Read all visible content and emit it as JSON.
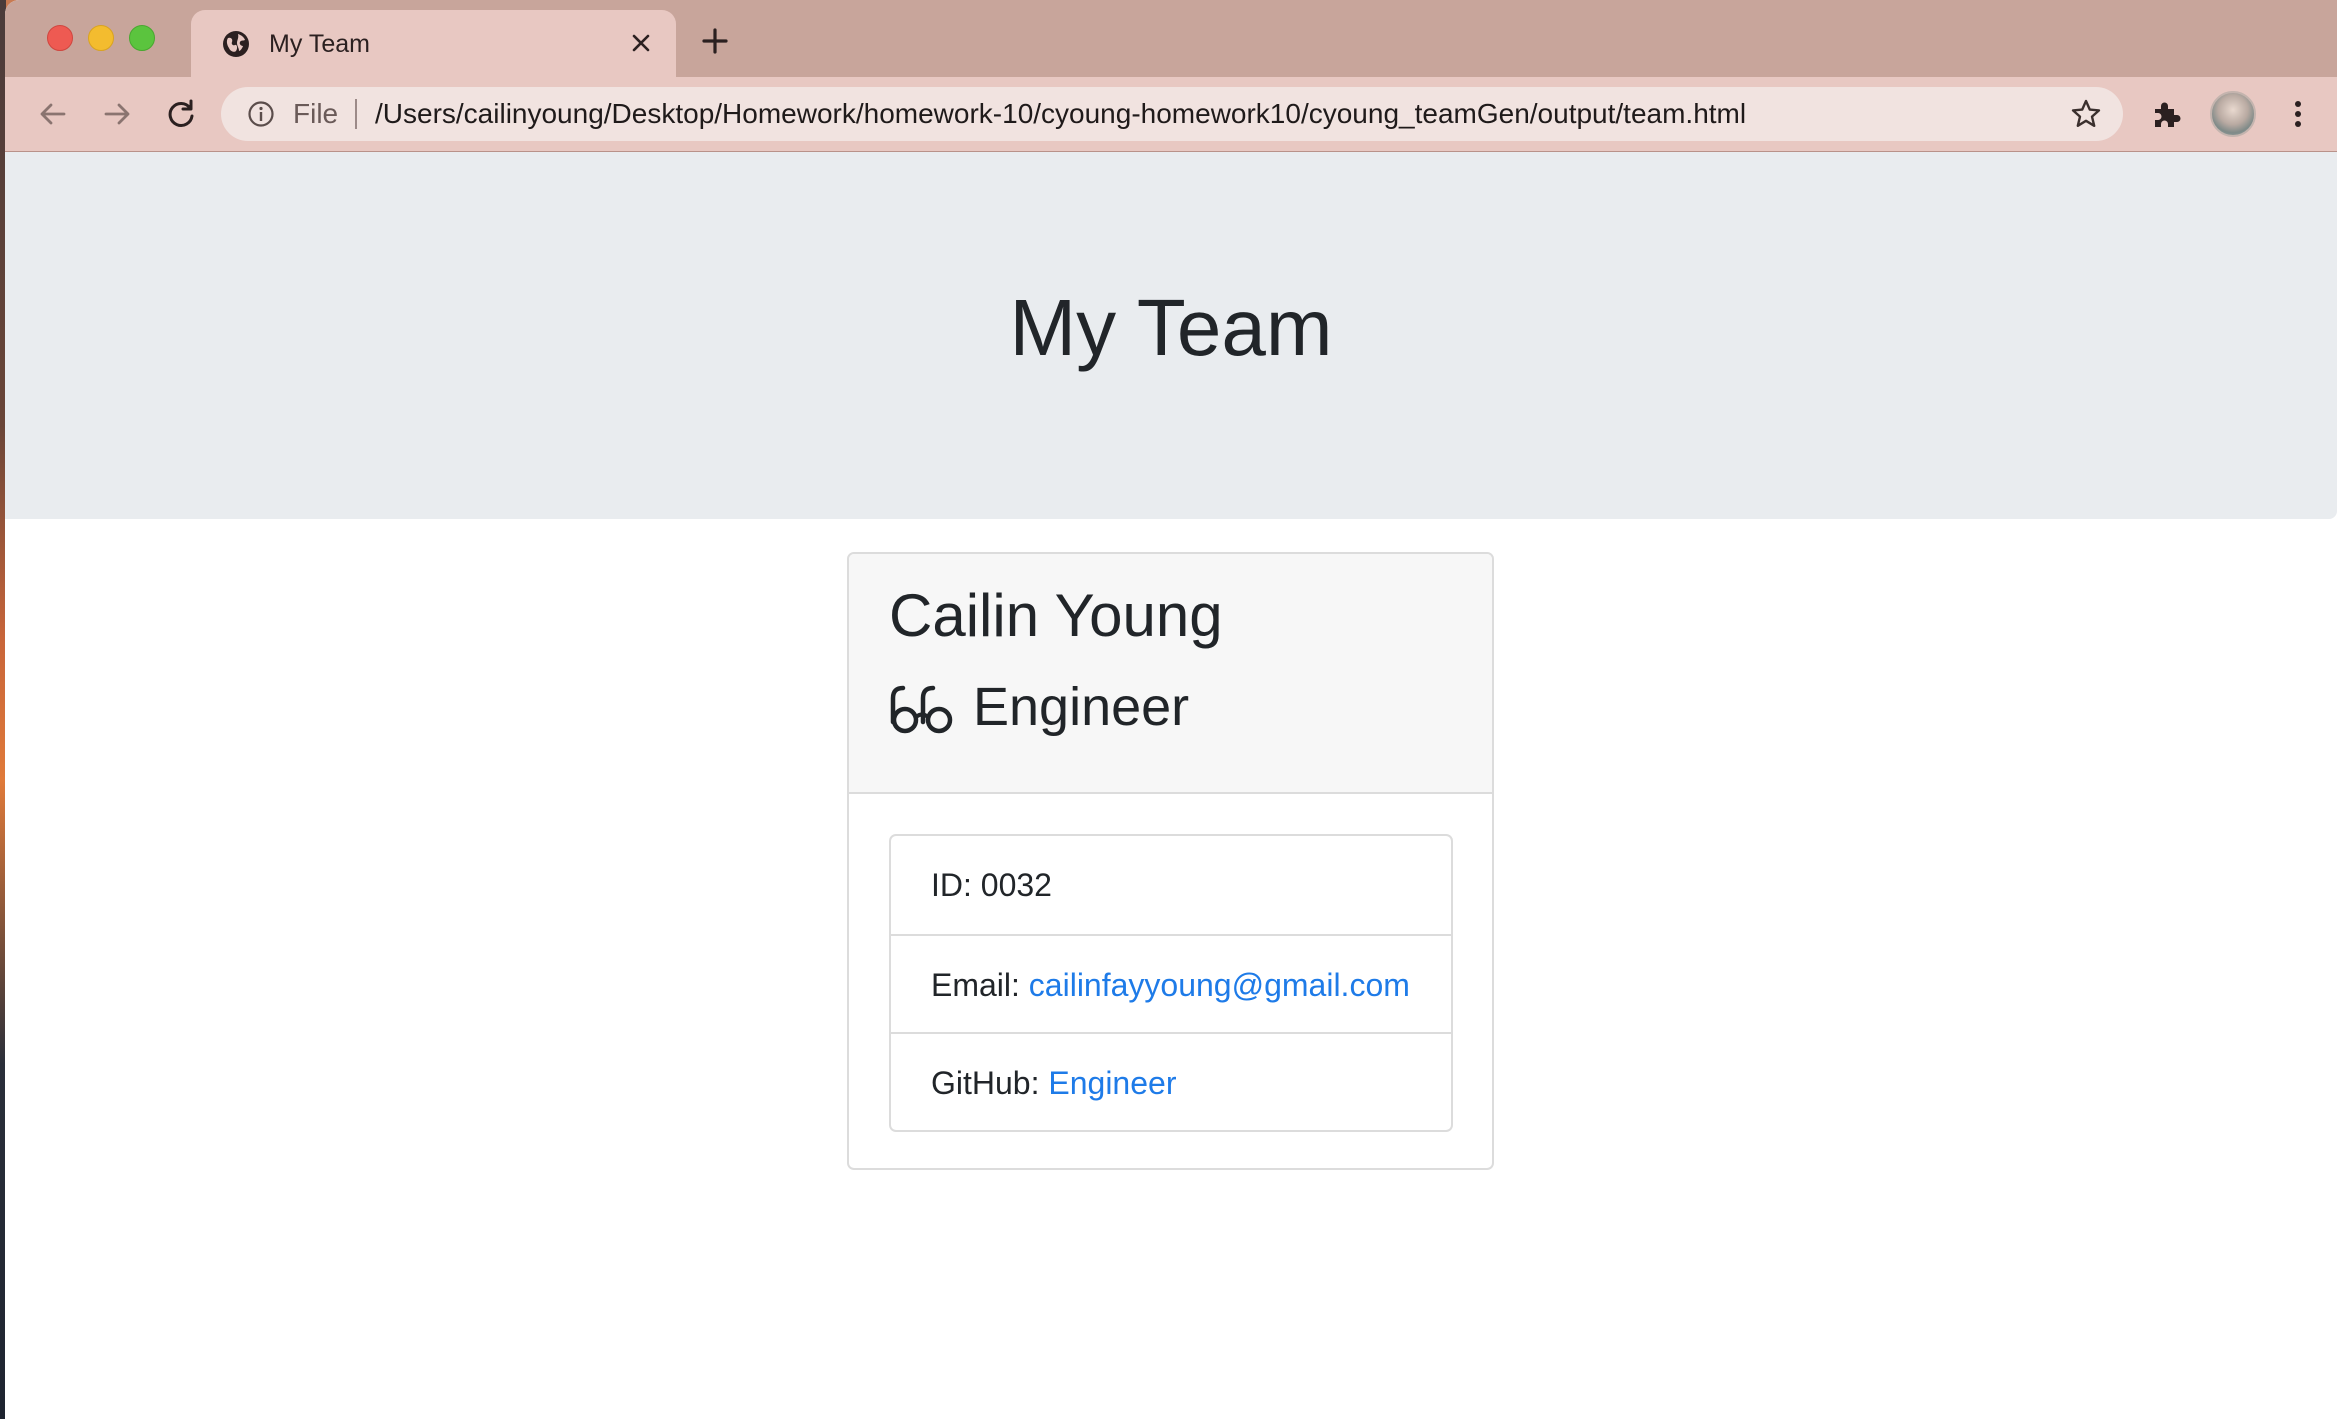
{
  "browser": {
    "tab": {
      "title": "My Team",
      "favicon": "globe-icon"
    },
    "address_bar": {
      "scheme_label": "File",
      "url": "/Users/cailinyoung/Desktop/Homework/homework-10/cyoung-homework10/cyoung_teamGen/output/team.html"
    },
    "icons": {
      "back": "back-arrow-icon",
      "forward": "forward-arrow-icon",
      "reload": "reload-icon",
      "info": "info-icon",
      "bookmark": "star-icon",
      "extensions": "puzzle-icon",
      "menu": "kebab-menu-icon"
    },
    "colors": {
      "tabstrip": "#c8a59b",
      "toolbar": "#e8c8c2"
    }
  },
  "page": {
    "title": "My Team",
    "employee": {
      "name": "Cailin Young",
      "role": "Engineer",
      "role_icon": "glasses-icon",
      "id_label": "ID:",
      "id_value": "0032",
      "email_label": "Email:",
      "email_value": "cailinfayyoung@gmail.com",
      "github_label": "GitHub:",
      "github_value": "Engineer"
    },
    "colors": {
      "jumbotron": "#e9ecef",
      "link": "#1e7be8"
    }
  }
}
